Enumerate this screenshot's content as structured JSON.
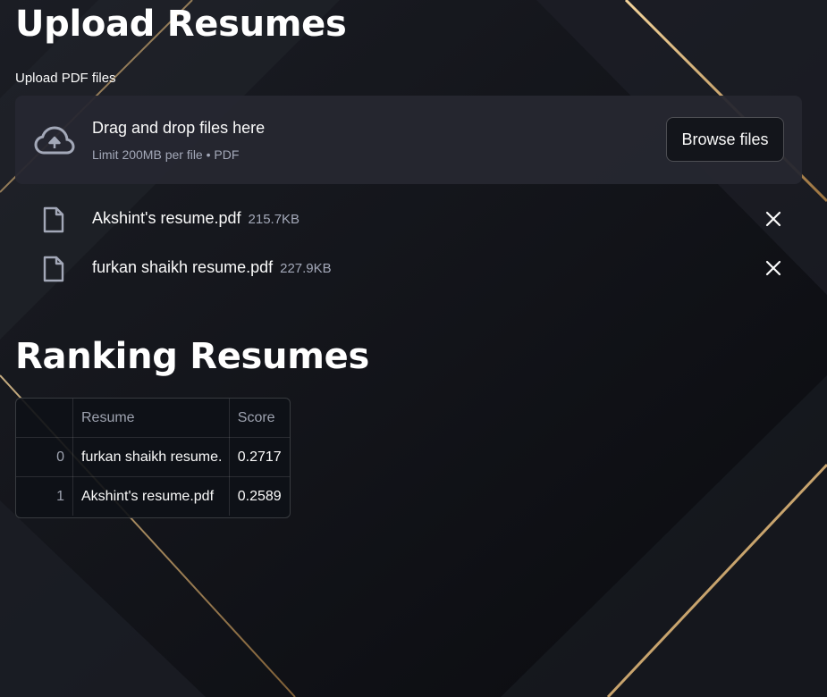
{
  "upload": {
    "title": "Upload Resumes",
    "label": "Upload PDF files",
    "dropzone_text": "Drag and drop files here",
    "dropzone_hint": "Limit 200MB per file • PDF",
    "browse_label": "Browse files",
    "files": [
      {
        "name": "Akshint's resume.pdf",
        "size": "215.7KB"
      },
      {
        "name": "furkan shaikh resume.pdf",
        "size": "227.9KB"
      }
    ]
  },
  "ranking": {
    "title": "Ranking Resumes",
    "columns": [
      "",
      "Resume",
      "Score"
    ],
    "rows": [
      {
        "index": "0",
        "resume": "furkan shaikh resume.",
        "score": "0.2717"
      },
      {
        "index": "1",
        "resume": "Akshint's resume.pdf",
        "score": "0.2589"
      }
    ]
  },
  "colors": {
    "background": "#0f1116",
    "panel": "#262730",
    "gold_accent": "#c9a063",
    "muted_text": "#a3a8b8"
  },
  "icons": [
    "cloud-upload-icon",
    "file-icon",
    "close-icon"
  ]
}
